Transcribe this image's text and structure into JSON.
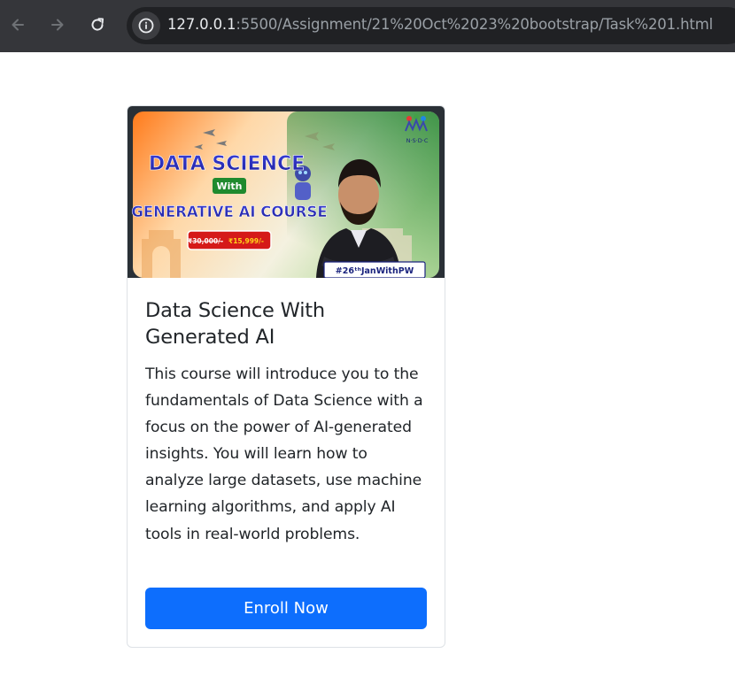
{
  "browser": {
    "url_host": "127.0.0.1",
    "url_path": ":5500/Assignment/21%20Oct%2023%20bootstrap/Task%201.html"
  },
  "banner": {
    "headline_line1": "DATA SCIENCE",
    "headline_with": "With",
    "headline_line2": "GENERATIVE AI COURSE",
    "price_old": "₹30,000/-",
    "price_new": "₹15,999/-",
    "hashtag": "#26ᵗʰJanWithPW",
    "logo_text": "N·S·D·C"
  },
  "card": {
    "title": "Data Science With Generated AI",
    "text": "This course will introduce you to the fundamentals of Data Science with a focus on the power of AI-generated insights. You will learn how to analyze large datasets, use machine learning algorithms, and apply AI tools in real-world problems.",
    "button_label": "Enroll Now"
  },
  "colors": {
    "toolbar": "#35363a",
    "omnibox": "#202124",
    "primary": "#0d6efd",
    "border": "#dee2e6"
  }
}
